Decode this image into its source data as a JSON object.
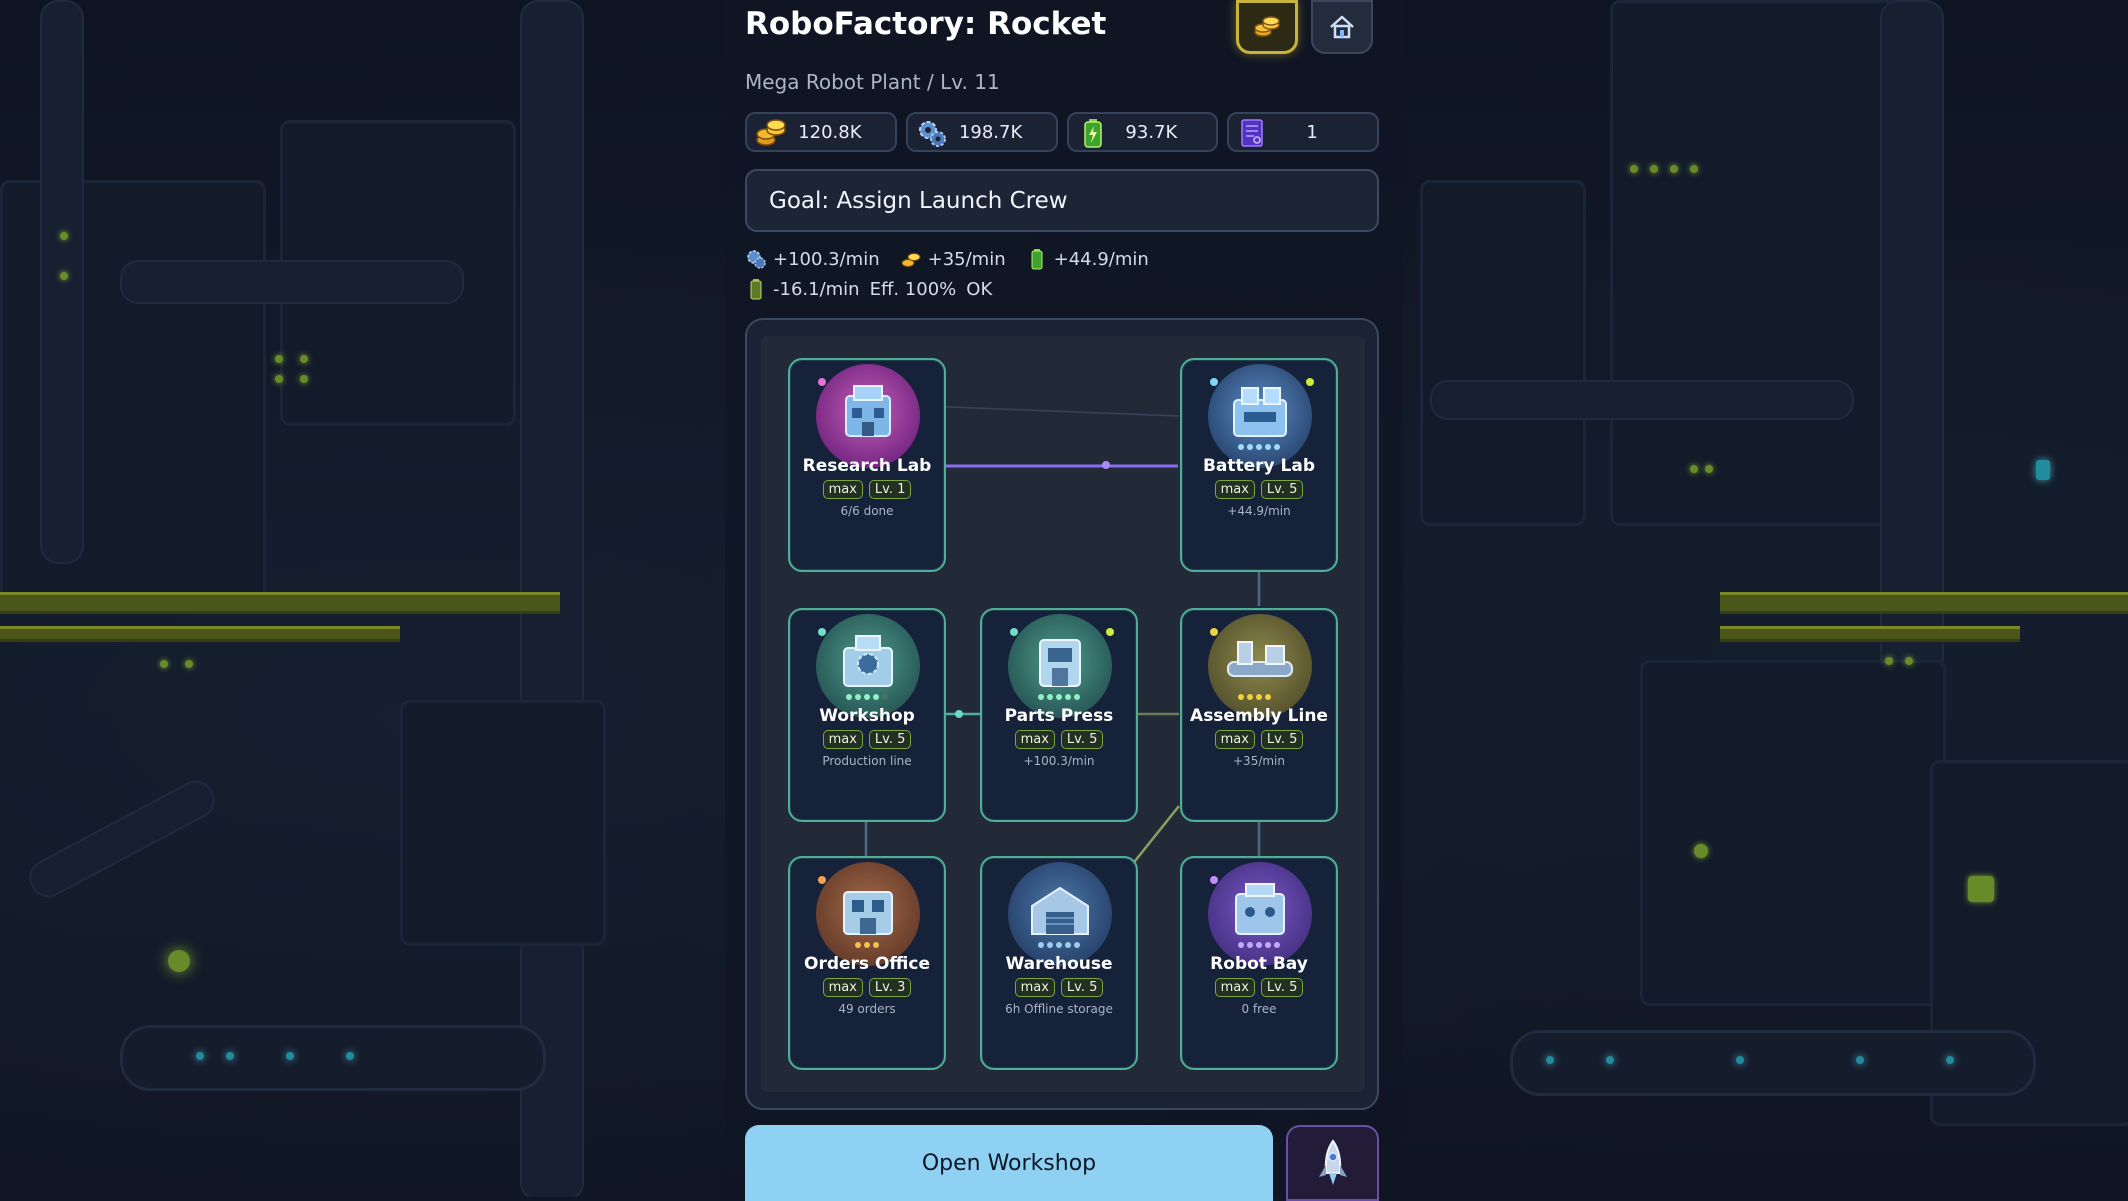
{
  "header": {
    "title": "RoboFactory: Rocket",
    "subtitle": "Mega Robot Plant / Lv. 11",
    "coin_button_icon": "coin-stack-icon",
    "home_button_icon": "home-icon"
  },
  "resources": [
    {
      "icon": "coins-icon",
      "value": "120.8K",
      "color": "#f0b52c"
    },
    {
      "icon": "gears-icon",
      "value": "198.7K",
      "color": "#6aa6e6"
    },
    {
      "icon": "battery-icon",
      "value": "93.7K",
      "color": "#5bd34a"
    },
    {
      "icon": "blueprint-icon",
      "value": "1",
      "color": "#6a45d8"
    }
  ],
  "goal": {
    "text": "Goal: Assign Launch Crew"
  },
  "rates": {
    "gears": "+100.3/min",
    "coins": "+35/min",
    "battery": "+44.9/min",
    "battery_drain": "-16.1/min",
    "efficiency": "Eff. 100%",
    "status": "OK"
  },
  "buildings": {
    "research_lab": {
      "name": "Research Lab",
      "max": "max",
      "level": "Lv. 1",
      "info": "6/6 done"
    },
    "battery_lab": {
      "name": "Battery Lab",
      "max": "max",
      "level": "Lv. 5",
      "info": "+44.9/min"
    },
    "workshop": {
      "name": "Workshop",
      "max": "max",
      "level": "Lv. 5",
      "info": "Production line"
    },
    "parts_press": {
      "name": "Parts Press",
      "max": "max",
      "level": "Lv. 5",
      "info": "+100.3/min"
    },
    "assembly_line": {
      "name": "Assembly Line",
      "max": "max",
      "level": "Lv. 5",
      "info": "+35/min"
    },
    "orders_office": {
      "name": "Orders Office",
      "max": "max",
      "level": "Lv. 3",
      "info": "49 orders"
    },
    "warehouse": {
      "name": "Warehouse",
      "max": "max",
      "level": "Lv. 5",
      "info": "6h Offline storage"
    },
    "robot_bay": {
      "name": "Robot Bay",
      "max": "max",
      "level": "Lv. 5",
      "info": "0 free"
    }
  },
  "actions": {
    "open_label": "Open Workshop",
    "rocket_icon": "rocket-icon"
  },
  "colors": {
    "accent_green": "#4fae96",
    "tag_border": "#7ca73c",
    "button_blue": "#8fd1f2",
    "link_purple": "#8a6cf0"
  }
}
